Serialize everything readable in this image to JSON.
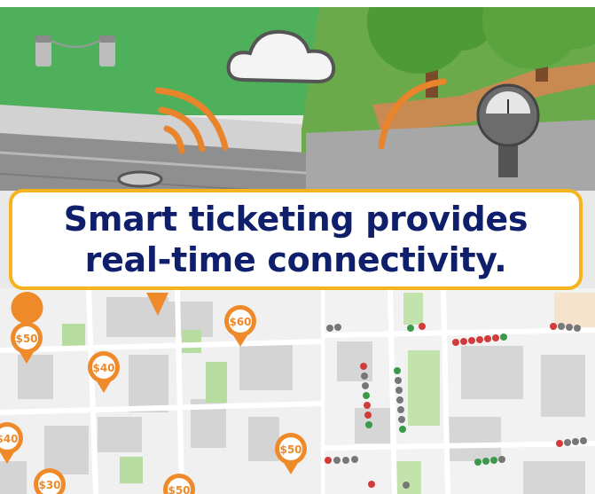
{
  "caption": {
    "line1": "Smart ticketing provides",
    "line2": "real-time connectivity."
  },
  "price_pins": {
    "left_map": [
      "$50",
      "$40",
      "$60",
      "$40",
      "$30",
      "$50",
      "$50"
    ]
  },
  "colors": {
    "caption_text": "#0f1f6b",
    "caption_border": "#f5b41e",
    "signal_orange": "#e8842b",
    "grass": "#4fb05c",
    "tree_green": "#4e9a35",
    "pin_orange": "#ee8a2a",
    "status_red": "#d23b3b",
    "status_green": "#3a9a4a",
    "status_gray": "#777777"
  },
  "icons": [
    "cloud-icon",
    "wifi-signal-icon",
    "parking-meter-icon",
    "price-pin-icon",
    "sensor-icon",
    "bollard-icon",
    "tree-icon"
  ]
}
